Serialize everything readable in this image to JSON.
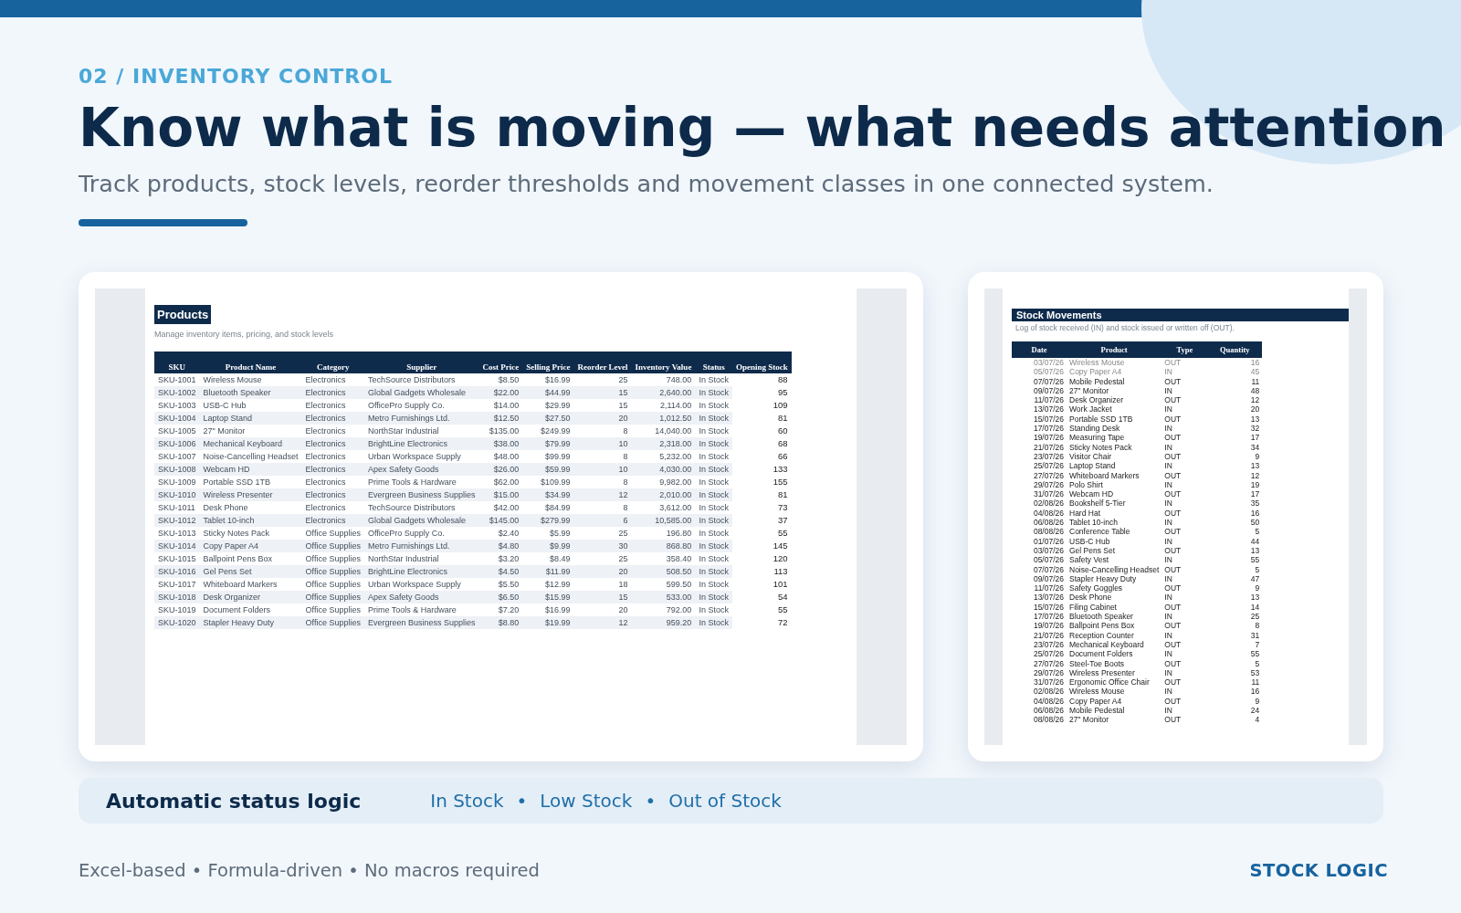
{
  "eyebrow": "02 / INVENTORY CONTROL",
  "title": "Know what is moving — what needs attention",
  "subtitle": "Track products, stock levels, reorder thresholds and movement classes in one connected system.",
  "products_sheet": {
    "title": "Products",
    "caption": "Manage inventory items, pricing, and stock levels",
    "columns": [
      "SKU",
      "Product Name",
      "Category",
      "Supplier",
      "Cost Price",
      "Selling Price",
      "Reorder Level",
      "Inventory Value",
      "Status",
      "Opening Stock"
    ],
    "rows": [
      [
        "SKU-1001",
        "Wireless Mouse",
        "Electronics",
        "TechSource Distributors",
        "$8.50",
        "$16.99",
        "25",
        "748.00",
        "In Stock",
        "88"
      ],
      [
        "SKU-1002",
        "Bluetooth Speaker",
        "Electronics",
        "Global Gadgets Wholesale",
        "$22.00",
        "$44.99",
        "15",
        "2,640.00",
        "In Stock",
        "95"
      ],
      [
        "SKU-1003",
        "USB-C Hub",
        "Electronics",
        "OfficePro Supply Co.",
        "$14.00",
        "$29.99",
        "15",
        "2,114.00",
        "In Stock",
        "109"
      ],
      [
        "SKU-1004",
        "Laptop Stand",
        "Electronics",
        "Metro Furnishings Ltd.",
        "$12.50",
        "$27.50",
        "20",
        "1,012.50",
        "In Stock",
        "81"
      ],
      [
        "SKU-1005",
        "27\" Monitor",
        "Electronics",
        "NorthStar Industrial",
        "$135.00",
        "$249.99",
        "8",
        "14,040.00",
        "In Stock",
        "60"
      ],
      [
        "SKU-1006",
        "Mechanical Keyboard",
        "Electronics",
        "BrightLine Electronics",
        "$38.00",
        "$79.99",
        "10",
        "2,318.00",
        "In Stock",
        "68"
      ],
      [
        "SKU-1007",
        "Noise-Cancelling Headset",
        "Electronics",
        "Urban Workspace Supply",
        "$48.00",
        "$99.99",
        "8",
        "5,232.00",
        "In Stock",
        "66"
      ],
      [
        "SKU-1008",
        "Webcam HD",
        "Electronics",
        "Apex Safety Goods",
        "$26.00",
        "$59.99",
        "10",
        "4,030.00",
        "In Stock",
        "133"
      ],
      [
        "SKU-1009",
        "Portable SSD 1TB",
        "Electronics",
        "Prime Tools & Hardware",
        "$62.00",
        "$109.99",
        "8",
        "9,982.00",
        "In Stock",
        "155"
      ],
      [
        "SKU-1010",
        "Wireless Presenter",
        "Electronics",
        "Evergreen Business Supplies",
        "$15.00",
        "$34.99",
        "12",
        "2,010.00",
        "In Stock",
        "81"
      ],
      [
        "SKU-1011",
        "Desk Phone",
        "Electronics",
        "TechSource Distributors",
        "$42.00",
        "$84.99",
        "8",
        "3,612.00",
        "In Stock",
        "73"
      ],
      [
        "SKU-1012",
        "Tablet 10-inch",
        "Electronics",
        "Global Gadgets Wholesale",
        "$145.00",
        "$279.99",
        "6",
        "10,585.00",
        "In Stock",
        "37"
      ],
      [
        "SKU-1013",
        "Sticky Notes Pack",
        "Office Supplies",
        "OfficePro Supply Co.",
        "$2.40",
        "$5.99",
        "25",
        "196.80",
        "In Stock",
        "55"
      ],
      [
        "SKU-1014",
        "Copy Paper A4",
        "Office Supplies",
        "Metro Furnishings Ltd.",
        "$4.80",
        "$9.99",
        "30",
        "868.80",
        "In Stock",
        "145"
      ],
      [
        "SKU-1015",
        "Ballpoint Pens Box",
        "Office Supplies",
        "NorthStar Industrial",
        "$3.20",
        "$8.49",
        "25",
        "358.40",
        "In Stock",
        "120"
      ],
      [
        "SKU-1016",
        "Gel Pens Set",
        "Office Supplies",
        "BrightLine Electronics",
        "$4.50",
        "$11.99",
        "20",
        "508.50",
        "In Stock",
        "113"
      ],
      [
        "SKU-1017",
        "Whiteboard Markers",
        "Office Supplies",
        "Urban Workspace Supply",
        "$5.50",
        "$12.99",
        "18",
        "599.50",
        "In Stock",
        "101"
      ],
      [
        "SKU-1018",
        "Desk Organizer",
        "Office Supplies",
        "Apex Safety Goods",
        "$6.50",
        "$15.99",
        "15",
        "533.00",
        "In Stock",
        "54"
      ],
      [
        "SKU-1019",
        "Document Folders",
        "Office Supplies",
        "Prime Tools & Hardware",
        "$7.20",
        "$16.99",
        "20",
        "792.00",
        "In Stock",
        "55"
      ],
      [
        "SKU-1020",
        "Stapler Heavy Duty",
        "Office Supplies",
        "Evergreen Business Supplies",
        "$8.80",
        "$19.99",
        "12",
        "959.20",
        "In Stock",
        "72"
      ]
    ]
  },
  "movements_sheet": {
    "title": "Stock Movements",
    "caption": "Log of stock received (IN) and stock issued or written off (OUT).",
    "columns": [
      "Date",
      "Product",
      "Type",
      "Quantity"
    ],
    "rows": [
      {
        "cells": [
          "03/07/26",
          "Wireless Mouse",
          "OUT",
          "16"
        ],
        "faded": true
      },
      {
        "cells": [
          "05/07/26",
          "Copy Paper A4",
          "IN",
          "45"
        ],
        "faded": true
      },
      {
        "cells": [
          "07/07/26",
          "Mobile Pedestal",
          "OUT",
          "11"
        ]
      },
      {
        "cells": [
          "09/07/26",
          "27\" Monitor",
          "IN",
          "48"
        ]
      },
      {
        "cells": [
          "11/07/26",
          "Desk Organizer",
          "OUT",
          "12"
        ]
      },
      {
        "cells": [
          "13/07/26",
          "Work Jacket",
          "IN",
          "20"
        ]
      },
      {
        "cells": [
          "15/07/26",
          "Portable SSD 1TB",
          "OUT",
          "13"
        ]
      },
      {
        "cells": [
          "17/07/26",
          "Standing Desk",
          "IN",
          "32"
        ]
      },
      {
        "cells": [
          "19/07/26",
          "Measuring Tape",
          "OUT",
          "17"
        ]
      },
      {
        "cells": [
          "21/07/26",
          "Sticky Notes Pack",
          "IN",
          "34"
        ]
      },
      {
        "cells": [
          "23/07/26",
          "Visitor Chair",
          "OUT",
          "9"
        ]
      },
      {
        "cells": [
          "25/07/26",
          "Laptop Stand",
          "IN",
          "13"
        ]
      },
      {
        "cells": [
          "27/07/26",
          "Whiteboard Markers",
          "OUT",
          "12"
        ]
      },
      {
        "cells": [
          "29/07/26",
          "Polo Shirt",
          "IN",
          "19"
        ]
      },
      {
        "cells": [
          "31/07/26",
          "Webcam HD",
          "OUT",
          "17"
        ]
      },
      {
        "cells": [
          "02/08/26",
          "Bookshelf 5-Tier",
          "IN",
          "35"
        ]
      },
      {
        "cells": [
          "04/08/26",
          "Hard Hat",
          "OUT",
          "16"
        ]
      },
      {
        "cells": [
          "06/08/26",
          "Tablet 10-inch",
          "IN",
          "50"
        ]
      },
      {
        "cells": [
          "08/08/26",
          "Conference Table",
          "OUT",
          "5"
        ]
      },
      {
        "cells": [
          "01/07/26",
          "USB-C Hub",
          "IN",
          "44"
        ]
      },
      {
        "cells": [
          "03/07/26",
          "Gel Pens Set",
          "OUT",
          "13"
        ]
      },
      {
        "cells": [
          "05/07/26",
          "Safety Vest",
          "IN",
          "55"
        ]
      },
      {
        "cells": [
          "07/07/26",
          "Noise-Cancelling Headset",
          "OUT",
          "5"
        ]
      },
      {
        "cells": [
          "09/07/26",
          "Stapler Heavy Duty",
          "IN",
          "47"
        ]
      },
      {
        "cells": [
          "11/07/26",
          "Safety Goggles",
          "OUT",
          "9"
        ]
      },
      {
        "cells": [
          "13/07/26",
          "Desk Phone",
          "IN",
          "13"
        ]
      },
      {
        "cells": [
          "15/07/26",
          "Filing Cabinet",
          "OUT",
          "14"
        ]
      },
      {
        "cells": [
          "17/07/26",
          "Bluetooth Speaker",
          "IN",
          "25"
        ]
      },
      {
        "cells": [
          "19/07/26",
          "Ballpoint Pens Box",
          "OUT",
          "8"
        ]
      },
      {
        "cells": [
          "21/07/26",
          "Reception Counter",
          "IN",
          "31"
        ]
      },
      {
        "cells": [
          "23/07/26",
          "Mechanical Keyboard",
          "OUT",
          "7"
        ]
      },
      {
        "cells": [
          "25/07/26",
          "Document Folders",
          "IN",
          "55"
        ]
      },
      {
        "cells": [
          "27/07/26",
          "Steel-Toe Boots",
          "OUT",
          "5"
        ]
      },
      {
        "cells": [
          "29/07/26",
          "Wireless Presenter",
          "IN",
          "53"
        ]
      },
      {
        "cells": [
          "31/07/26",
          "Ergonomic Office Chair",
          "OUT",
          "11"
        ]
      },
      {
        "cells": [
          "02/08/26",
          "Wireless Mouse",
          "IN",
          "16"
        ]
      },
      {
        "cells": [
          "04/08/26",
          "Copy Paper A4",
          "OUT",
          "9"
        ]
      },
      {
        "cells": [
          "06/08/26",
          "Mobile Pedestal",
          "IN",
          "24"
        ]
      },
      {
        "cells": [
          "08/08/26",
          "27\" Monitor",
          "OUT",
          "4"
        ]
      }
    ]
  },
  "status_logic": {
    "label": "Automatic status logic",
    "states": [
      "In Stock",
      "Low Stock",
      "Out of Stock"
    ],
    "separator": "•"
  },
  "footer": {
    "note": "Excel-based • Formula-driven • No macros required",
    "brand": "STOCK LOGIC"
  }
}
